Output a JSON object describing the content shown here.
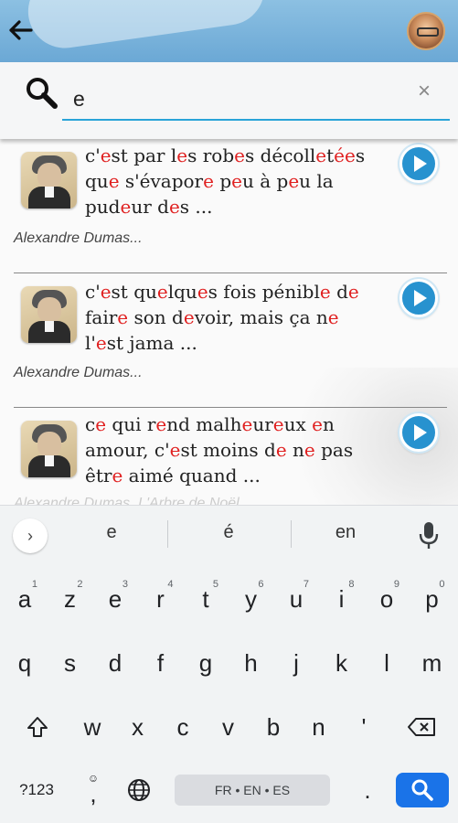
{
  "header": {
    "back_icon": "arrow-left-icon",
    "avatar_icon": "profile-avatar"
  },
  "search": {
    "value": "e",
    "search_icon": "magnifier-icon",
    "clear_label": "×"
  },
  "results": [
    {
      "quote_parts": [
        {
          "t": "c'"
        },
        {
          "t": "e",
          "h": 1
        },
        {
          "t": "st par l"
        },
        {
          "t": "e",
          "h": 1
        },
        {
          "t": "s rob"
        },
        {
          "t": "e",
          "h": 1
        },
        {
          "t": "s décoll"
        },
        {
          "t": "e",
          "h": 1
        },
        {
          "t": "t"
        },
        {
          "t": "é",
          "h": 1
        },
        {
          "t": "e",
          "h": 1
        },
        {
          "t": "s\nqu"
        },
        {
          "t": "e",
          "h": 1
        },
        {
          "t": " s'évapor"
        },
        {
          "t": "e",
          "h": 1
        },
        {
          "t": " p"
        },
        {
          "t": "e",
          "h": 1
        },
        {
          "t": "u à p"
        },
        {
          "t": "e",
          "h": 1
        },
        {
          "t": "u la\npud"
        },
        {
          "t": "e",
          "h": 1
        },
        {
          "t": "ur d"
        },
        {
          "t": "e",
          "h": 1
        },
        {
          "t": "s ..."
        }
      ],
      "author": "Alexandre Dumas..."
    },
    {
      "quote_parts": [
        {
          "t": "c'"
        },
        {
          "t": "e",
          "h": 1
        },
        {
          "t": "st qu"
        },
        {
          "t": "e",
          "h": 1
        },
        {
          "t": "lqu"
        },
        {
          "t": "e",
          "h": 1
        },
        {
          "t": "s fois pénibl"
        },
        {
          "t": "e",
          "h": 1
        },
        {
          "t": " d"
        },
        {
          "t": "e",
          "h": 1
        },
        {
          "t": "\nfair"
        },
        {
          "t": "e",
          "h": 1
        },
        {
          "t": " son d"
        },
        {
          "t": "e",
          "h": 1
        },
        {
          "t": "voir, mais ça n"
        },
        {
          "t": "e",
          "h": 1
        },
        {
          "t": "\nl'"
        },
        {
          "t": "e",
          "h": 1
        },
        {
          "t": "st jama ..."
        }
      ],
      "author": "Alexandre Dumas..."
    },
    {
      "quote_parts": [
        {
          "t": "c"
        },
        {
          "t": "e",
          "h": 1
        },
        {
          "t": " qui r"
        },
        {
          "t": "e",
          "h": 1
        },
        {
          "t": "nd malh"
        },
        {
          "t": "e",
          "h": 1
        },
        {
          "t": "ur"
        },
        {
          "t": "e",
          "h": 1
        },
        {
          "t": "ux "
        },
        {
          "t": "e",
          "h": 1
        },
        {
          "t": "n\namour, c'"
        },
        {
          "t": "e",
          "h": 1
        },
        {
          "t": "st moins d"
        },
        {
          "t": "e",
          "h": 1
        },
        {
          "t": " n"
        },
        {
          "t": "e",
          "h": 1
        },
        {
          "t": " pas\nêtr"
        },
        {
          "t": "e",
          "h": 1
        },
        {
          "t": " aimé quand ..."
        }
      ],
      "author": "Alexandre Dumas, L'Arbre de Noël"
    }
  ],
  "keyboard": {
    "suggestions": [
      "e",
      "é",
      "en"
    ],
    "expand_label": "›",
    "row1": [
      [
        "a",
        "1"
      ],
      [
        "z",
        "2"
      ],
      [
        "e",
        "3"
      ],
      [
        "r",
        "4"
      ],
      [
        "t",
        "5"
      ],
      [
        "y",
        "6"
      ],
      [
        "u",
        "7"
      ],
      [
        "i",
        "8"
      ],
      [
        "o",
        "9"
      ],
      [
        "p",
        "0"
      ]
    ],
    "row2": [
      "q",
      "s",
      "d",
      "f",
      "g",
      "h",
      "j",
      "k",
      "l",
      "m"
    ],
    "row3": [
      "w",
      "x",
      "c",
      "v",
      "b",
      "n",
      "'"
    ],
    "symbols_label": "?123",
    "comma_label": ",",
    "space_label": "FR • EN • ES",
    "period_label": ".",
    "icons": {
      "shift": "shift-icon",
      "backspace": "backspace-icon",
      "emoji": "emoji-icon",
      "globe": "globe-icon",
      "mic": "mic-icon",
      "enter": "search-icon"
    }
  }
}
